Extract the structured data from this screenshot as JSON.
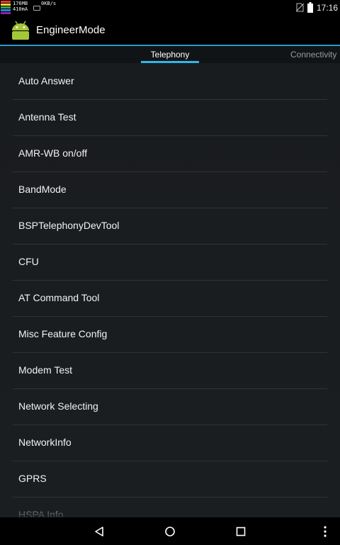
{
  "status_bar": {
    "memory": "176MB",
    "current": "410mA",
    "speed": "0KB/s",
    "time": "17:16",
    "icons": [
      "cpu-meter-icon",
      "phone-icon",
      "no-sim-icon",
      "battery-icon"
    ]
  },
  "action_bar": {
    "title": "EngineerMode",
    "icon": "android-icon"
  },
  "tabs": [
    {
      "label": "Telephony",
      "selected": true
    },
    {
      "label": "Connectivity",
      "selected": false
    }
  ],
  "list": {
    "items": [
      {
        "label": "Auto Answer"
      },
      {
        "label": "Antenna Test"
      },
      {
        "label": "AMR-WB on/off"
      },
      {
        "label": "BandMode"
      },
      {
        "label": "BSPTelephonyDevTool"
      },
      {
        "label": "CFU"
      },
      {
        "label": "AT Command Tool"
      },
      {
        "label": "Misc Feature Config"
      },
      {
        "label": "Modem Test"
      },
      {
        "label": "Network Selecting"
      },
      {
        "label": "NetworkInfo"
      },
      {
        "label": "GPRS"
      },
      {
        "label": "HSPA Info"
      }
    ]
  },
  "nav_bar": {
    "buttons": [
      "back-icon",
      "home-icon",
      "recents-icon",
      "overflow-menu-icon"
    ]
  },
  "colors": {
    "accent": "#33b5e5",
    "android_green": "#a4c639",
    "list_background": "#1a1d20",
    "divider": "#2e3236"
  }
}
